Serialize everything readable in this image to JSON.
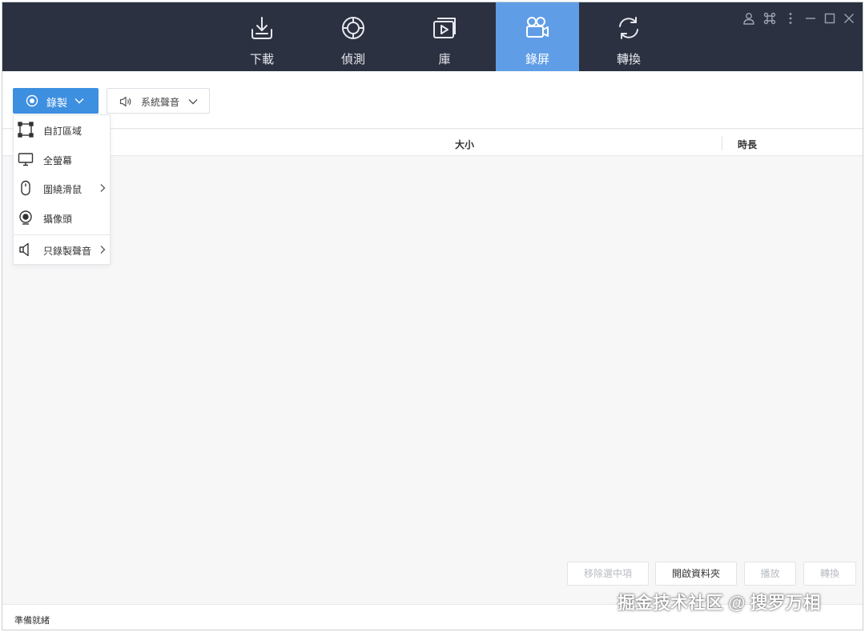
{
  "nav": {
    "tabs": [
      {
        "label": "下載",
        "icon": "download-icon"
      },
      {
        "label": "偵測",
        "icon": "detect-target-icon"
      },
      {
        "label": "庫",
        "icon": "library-icon"
      },
      {
        "label": "錄屏",
        "icon": "video-camera-icon"
      },
      {
        "label": "轉換",
        "icon": "convert-icon"
      }
    ],
    "active_tab": "錄屏"
  },
  "window_controls": [
    "user-icon",
    "shortcut-command-icon",
    "more-vertical-icon",
    "minimize-icon",
    "maximize-icon",
    "close-icon"
  ],
  "toolbar": {
    "record_label": "錄製",
    "audio_label": "系統聲音"
  },
  "record_menu": {
    "items": [
      {
        "label": "自訂區域",
        "icon": "custom-region-icon",
        "has_submenu": false
      },
      {
        "label": "全螢幕",
        "icon": "monitor-icon",
        "has_submenu": false
      },
      {
        "label": "圍繞滑鼠",
        "icon": "mouse-icon",
        "has_submenu": true
      },
      {
        "label": "攝像頭",
        "icon": "webcam-icon",
        "has_submenu": false
      },
      {
        "label": "只錄製聲音",
        "icon": "speaker-icon",
        "has_submenu": true
      }
    ]
  },
  "table": {
    "columns": [
      "大小",
      "時長"
    ]
  },
  "actions": {
    "remove_selected": "移除選中項",
    "open_folder": "開啟資料夾",
    "play": "播放",
    "convert": "轉換"
  },
  "status": {
    "text": "準備就緒"
  },
  "watermark": "掘金技术社区 @ 搜罗万相",
  "colors": {
    "topbar": "#2b3140",
    "active_tab": "#5f9ee6",
    "primary_button": "#3d8fe0"
  }
}
